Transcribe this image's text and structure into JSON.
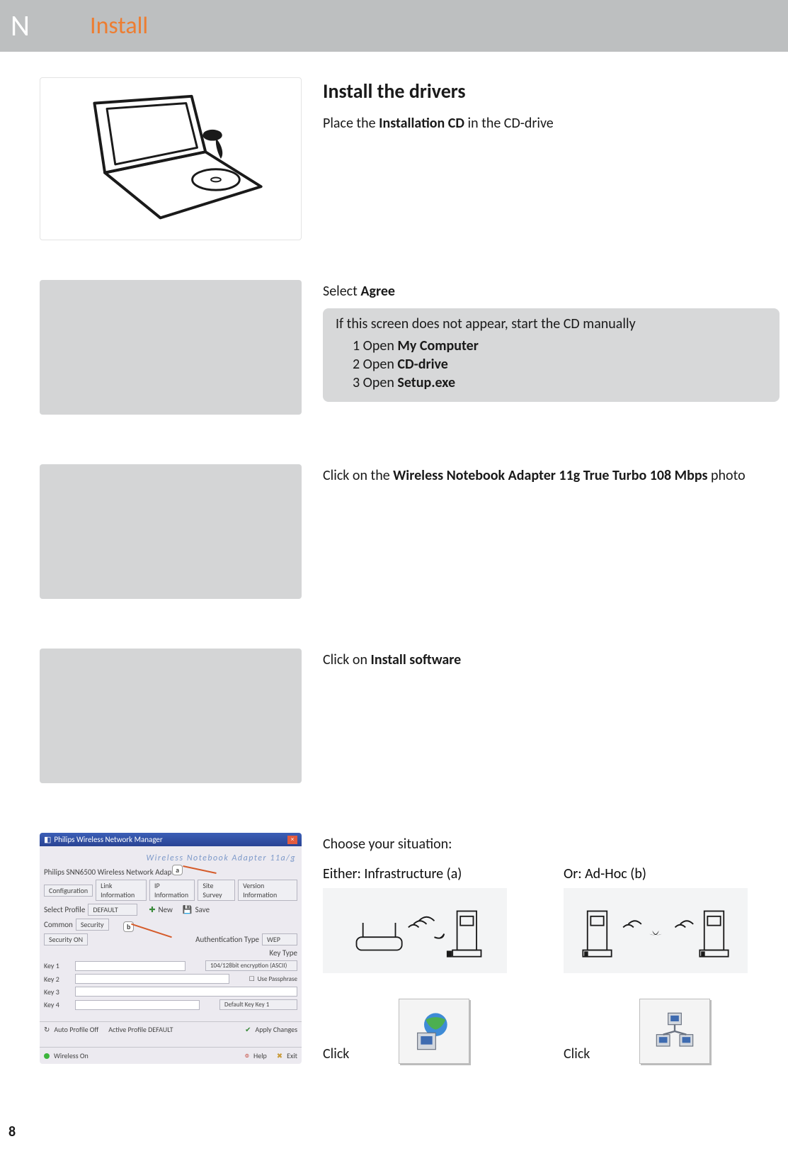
{
  "header": {
    "tab_letter": "N",
    "title": "Install"
  },
  "page_number": "8",
  "step1": {
    "heading": "Install the drivers",
    "body_prefix": "Place the ",
    "body_bold": "Installation CD",
    "body_suffix": " in the CD-drive"
  },
  "step2": {
    "body_prefix": "Select ",
    "body_bold": "Agree",
    "note_intro": "If this screen does not appear, start the CD manually",
    "note_items": {
      "l1_num": "1",
      "l1_prefix": " Open ",
      "l1_bold": "My Computer",
      "l2_num": "2",
      "l2_prefix": " Open ",
      "l2_bold": "CD-drive",
      "l3_num": "3",
      "l3_prefix": " Open ",
      "l3_bold": "Setup.exe"
    }
  },
  "step3": {
    "body_prefix": "Click on the ",
    "body_bold": "Wireless Notebook Adapter 11g True Turbo 108 Mbps",
    "body_suffix": " photo"
  },
  "step4": {
    "body_prefix": "Click on ",
    "body_bold": "Install software"
  },
  "step5": {
    "intro": "Choose your situation:",
    "colA_label": "Either: Infrastructure (a)",
    "colB_label": "Or: Ad-Hoc (b)",
    "click_label": "Click",
    "screenshot": {
      "window_title": "Philips Wireless Network Manager",
      "band": "Wireless Notebook Adapter 11a/g",
      "profile_text": "Philips SNN6500 Wireless Network Adapter",
      "tabs": [
        "Configuration",
        "Link Information",
        "IP Information",
        "Site Survey",
        "Version Information"
      ],
      "labels": {
        "select_profile": "Select Profile",
        "default": "DEFAULT",
        "new": "New",
        "save": "Save",
        "common": "Common",
        "security": "Security",
        "security_on": "Security ON",
        "auth_type": "Authentication Type",
        "wep": "WEP",
        "key_type": "Key Type",
        "enc_bits": "104/128bit encryption (ASCII)",
        "use_passphrase": "Use Passphrase",
        "default_key": "Default Key  Key 1",
        "key1": "Key 1",
        "key2": "Key 2",
        "key3": "Key 3",
        "key4": "Key 4",
        "auto_off": "Auto Profile Off",
        "active_profile": "Active Profile DEFAULT",
        "apply": "Apply Changes",
        "wireless_on": "Wireless On",
        "help": "Help",
        "exit": "Exit"
      },
      "callouts": {
        "a": "a",
        "b": "b"
      }
    }
  }
}
